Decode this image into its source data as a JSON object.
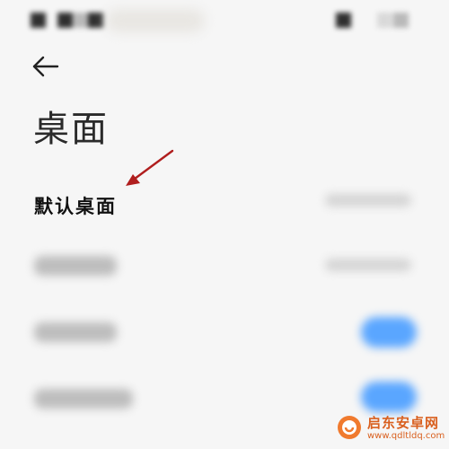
{
  "header": {
    "back_icon": "arrow-left-icon",
    "title": "桌面"
  },
  "settings": [
    {
      "label": "默认桌面",
      "control": "value"
    },
    {
      "label": "",
      "control": "value"
    },
    {
      "label": "",
      "control": "toggle"
    },
    {
      "label": "",
      "control": "toggle"
    }
  ],
  "annotation": {
    "type": "arrow",
    "color": "#b01e1e"
  },
  "watermark": {
    "name": "启东安卓网",
    "url": "www.qdltldq.com",
    "color": "#d9601f"
  },
  "colors": {
    "background": "#f6f6f6",
    "toggle_on": "#5aa6ff",
    "text_primary": "#111111"
  }
}
